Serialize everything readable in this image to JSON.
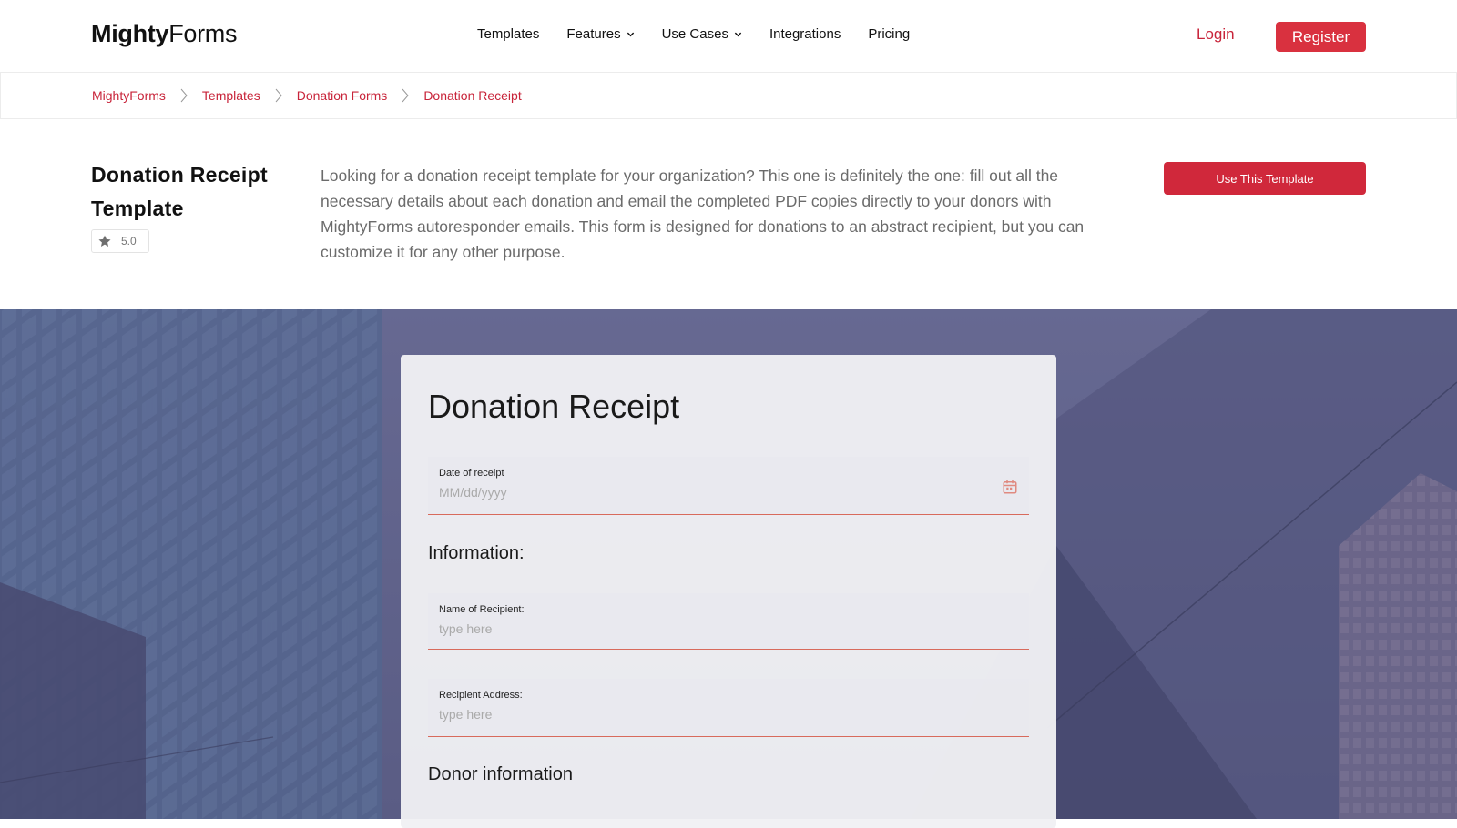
{
  "header": {
    "logo_bold": "Mighty",
    "logo_regular": "Forms",
    "nav": {
      "templates": "Templates",
      "features": "Features",
      "use_cases": "Use Cases",
      "integrations": "Integrations",
      "pricing": "Pricing"
    },
    "login": "Login",
    "register": "Register"
  },
  "breadcrumb": {
    "items": [
      "MightyForms",
      "Templates",
      "Donation Forms",
      "Donation Receipt"
    ]
  },
  "intro": {
    "title": "Donation Receipt Template",
    "rating": "5.0",
    "description": "Looking for a donation receipt template for your organization? This one is definitely the one: fill out all the necessary details about each donation and email the completed PDF copies directly to your donors with MightyForms autoresponder emails. This form is designed for donations to an abstract recipient, but you can customize it for any other purpose.",
    "use_button": "Use This Template"
  },
  "form": {
    "title": "Donation Receipt",
    "date": {
      "label": "Date of receipt",
      "placeholder": "MM/dd/yyyy"
    },
    "section_information": "Information:",
    "recipient_name": {
      "label": "Name of Recipient:",
      "placeholder": "type here"
    },
    "recipient_address": {
      "label": "Recipient Address:",
      "placeholder": "type here"
    },
    "section_donor": "Donor information"
  },
  "colors": {
    "accent": "#d0283b",
    "link": "#c8243a",
    "field_underline": "#d86a5c",
    "hero_overlay": "#5d5f86"
  },
  "icons": [
    "star-icon",
    "chevron-down-icon",
    "breadcrumb-separator-icon",
    "calendar-icon"
  ]
}
